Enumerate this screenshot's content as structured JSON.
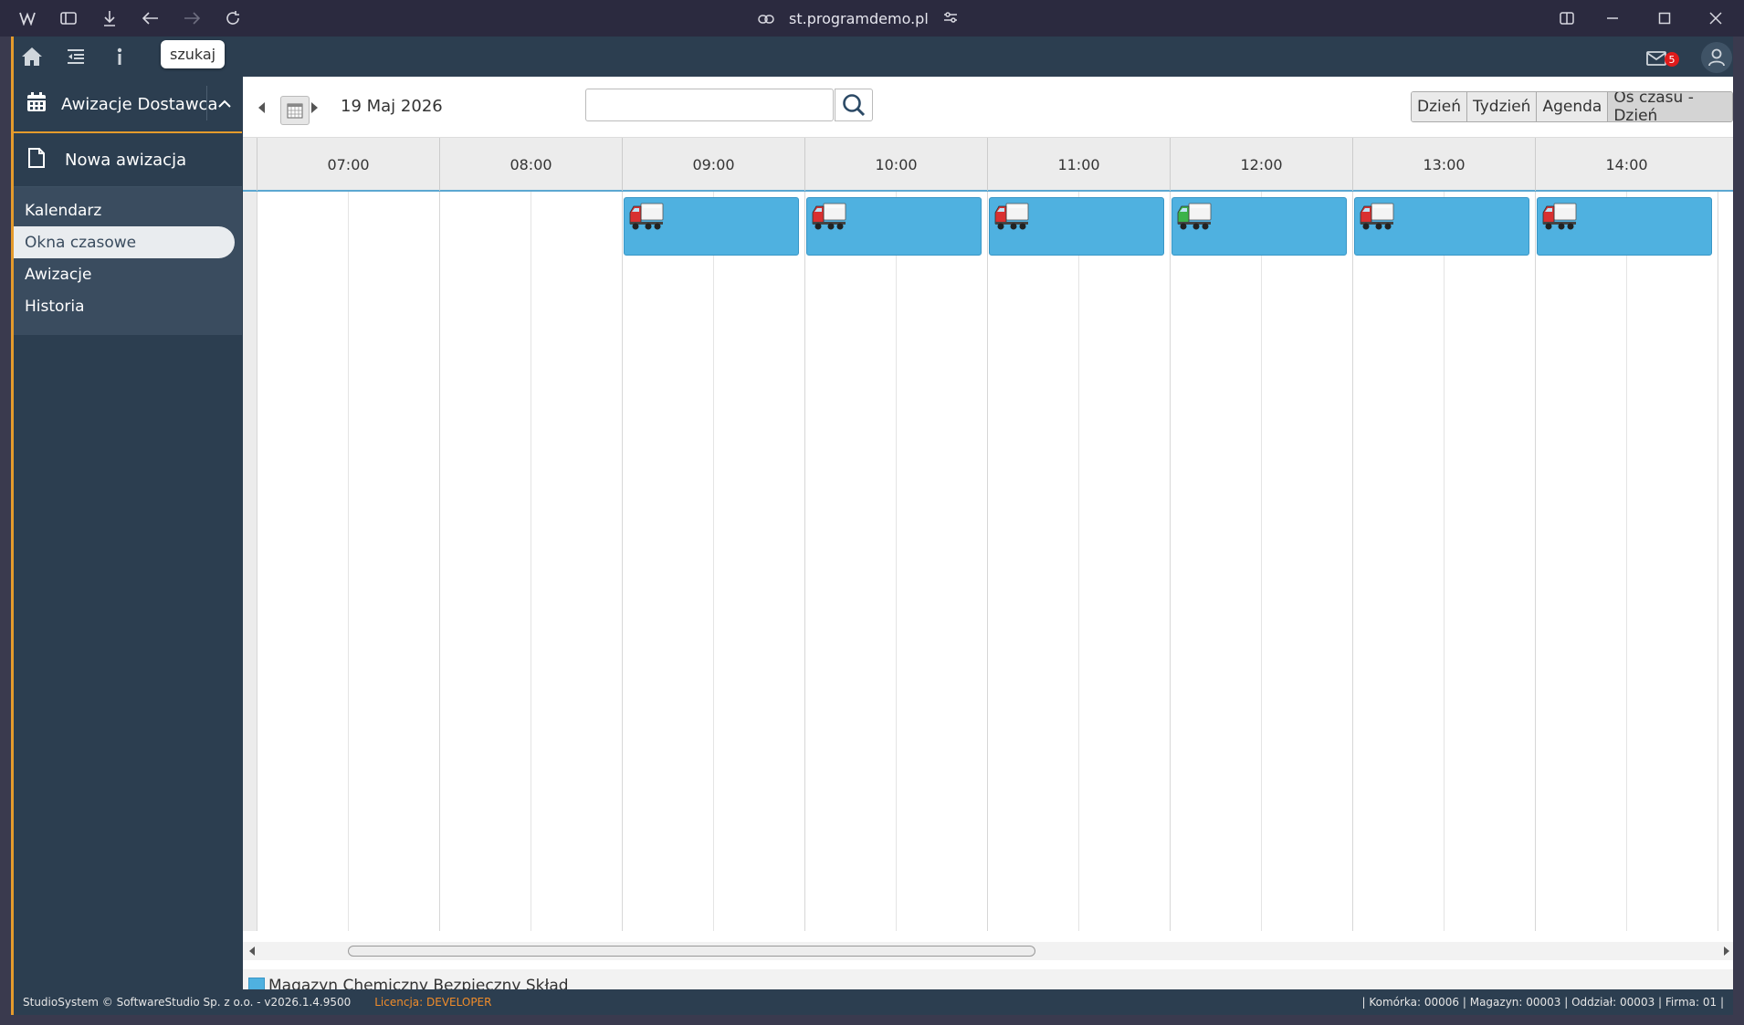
{
  "browser": {
    "url": "st.programdemo.pl"
  },
  "topbar": {
    "tooltip": "szukaj",
    "mail_count": "5"
  },
  "sidebar": {
    "module_title": "Awizacje Dostawca",
    "new_item": "Nowa awizacja",
    "items": [
      {
        "label": "Kalendarz"
      },
      {
        "label": "Okna czasowe"
      },
      {
        "label": "Awizacje"
      },
      {
        "label": "Historia"
      }
    ]
  },
  "toolbar": {
    "date": "19 Maj 2026",
    "search_value": "",
    "views": [
      "Dzień",
      "Tydzień",
      "Agenda",
      "Oś czasu - Dzień"
    ],
    "active_view": "Oś czasu - Dzień"
  },
  "timeline": {
    "hours": [
      "07:00",
      "08:00",
      "09:00",
      "10:00",
      "11:00",
      "12:00",
      "13:00",
      "14:00"
    ],
    "events": [
      {
        "start": "09:00",
        "truck": "red-truck-icon"
      },
      {
        "start": "10:00",
        "truck": "red-truck-icon"
      },
      {
        "start": "11:00",
        "truck": "red-truck-icon"
      },
      {
        "start": "12:00",
        "truck": "green-truck-icon"
      },
      {
        "start": "13:00",
        "truck": "red-truck-icon"
      },
      {
        "start": "14:00",
        "truck": "red-truck-icon"
      }
    ],
    "event_color": "#4fb1e0"
  },
  "legend": {
    "label": "Magazyn Chemiczny Bezpieczny Skład",
    "color": "#4fb1e0"
  },
  "footer": {
    "copyright": "StudioSystem © SoftwareStudio Sp. z o.o. - v2026.1.4.9500",
    "license": "Licencja: DEVELOPER",
    "info": "| Komórka: 00006 | Magazyn: 00003 | Oddział: 00003 | Firma: 01 |"
  },
  "colors": {
    "accent": "#e59b2c",
    "sidebar": "#2c3e50"
  }
}
